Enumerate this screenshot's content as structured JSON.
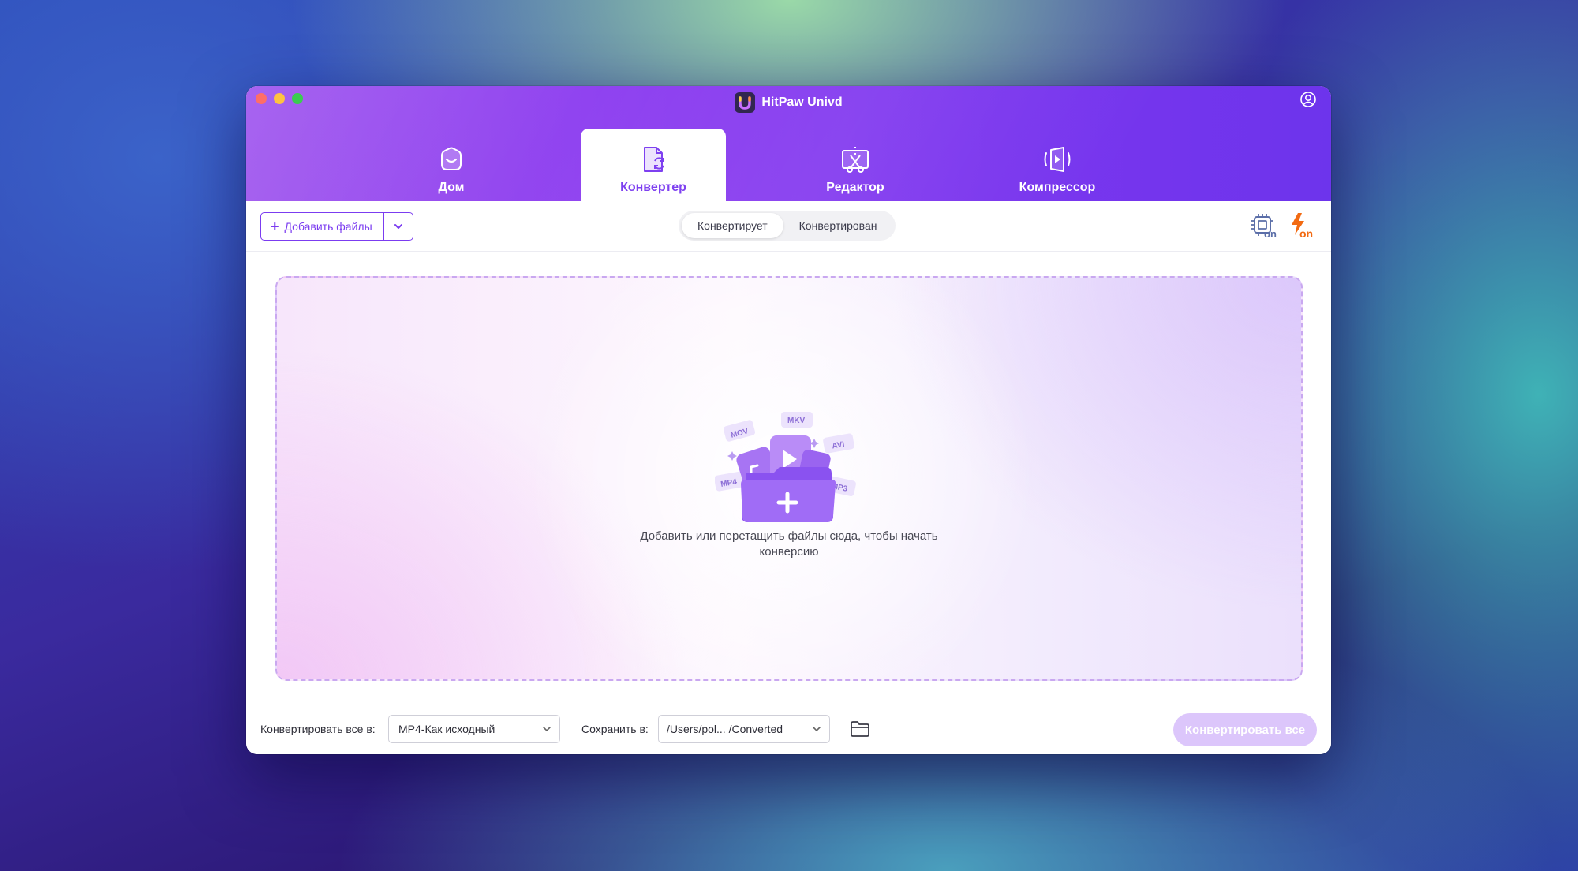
{
  "window": {
    "title": "HitPaw Univd"
  },
  "tabs": [
    {
      "label": "Дом",
      "icon": "home-icon"
    },
    {
      "label": "Конвертер",
      "icon": "converter-icon",
      "active": true
    },
    {
      "label": "Редактор",
      "icon": "editor-icon"
    },
    {
      "label": "Компрессор",
      "icon": "compressor-icon"
    }
  ],
  "toolbar": {
    "add_files_label": "Добавить файлы",
    "segments": [
      "Конвертирует",
      "Конвертирован"
    ],
    "active_segment": "Конвертирует",
    "hardware_accel_icon": "cpu-on-icon",
    "turbo_icon": "lightning-on-icon",
    "icon_badge_text": "on"
  },
  "dropzone": {
    "text_line1": "Добавить или перетащить файлы сюда, чтобы начать",
    "text_line2": "конверсию",
    "format_tags": [
      "MOV",
      "MKV",
      "AVI",
      "MP4",
      "MP3"
    ]
  },
  "footer": {
    "convert_all_to_label": "Конвертировать все в:",
    "convert_all_to_value": "MP4-Как исходный",
    "save_to_label": "Сохранить в:",
    "save_to_value": "/Users/pol... /Converted",
    "convert_all_button": "Конвертировать все"
  },
  "colors": {
    "accent": "#7b3cf0",
    "header_start": "#9d52ee",
    "header_end": "#6d34ec",
    "convert_all_disabled": "#dcc6fb",
    "turbo_orange": "#f26a12"
  }
}
